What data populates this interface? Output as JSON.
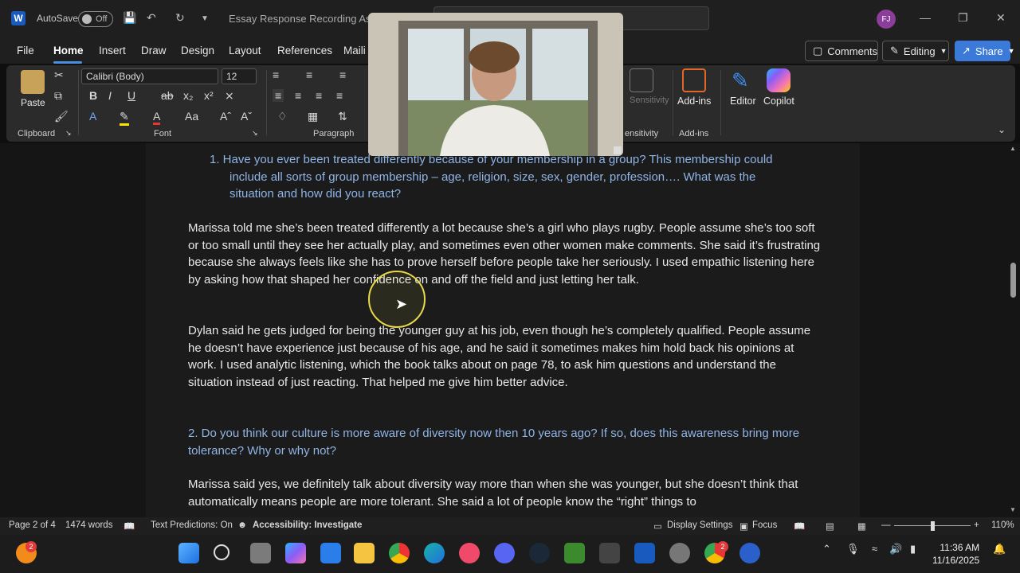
{
  "titlebar": {
    "autosave_label": "AutoSave",
    "autosave_state": "Off",
    "doc_title": "Essay Response Recording Assig",
    "avatar_initials": "FJ"
  },
  "menu": {
    "items": [
      "File",
      "Home",
      "Insert",
      "Draw",
      "Design",
      "Layout",
      "References",
      "Maili"
    ],
    "active": "Home",
    "comments_label": "Comments",
    "editing_label": "Editing",
    "share_label": "Share"
  },
  "ribbon": {
    "paste_label": "Paste",
    "clipboard_label": "Clipboard",
    "font_name": "Calibri (Body)",
    "font_size": "12",
    "font_label": "Font",
    "paragraph_label": "Paragraph",
    "sensitivity_label": "Sensitivity",
    "sensitivity_group": "ensitivity",
    "addins_label": "Add-ins",
    "addins_group": "Add-ins",
    "editor_label": "Editor",
    "copilot_label": "Copilot"
  },
  "document": {
    "q1": "1.   Have you ever been treated differently because of your membership in a group?  This membership could include all sorts of group membership – age, religion, size, sex, gender, profession…. What was the situation and how did you react?",
    "p1": "Marissa told me she’s been treated differently a lot because she’s a girl who plays rugby. People assume she’s too soft or too small until they see her actually play, and sometimes even other women make comments. She said it’s frustrating because she always feels like she has to prove herself before people take her seriously. I used empathic listening here by asking how that shaped her confidence on and off the field and just letting her talk.",
    "p2": "Dylan said he gets judged for being the younger guy at his job, even though he’s completely qualified. People assume he doesn’t have experience just because of his age, and he said it sometimes makes him hold back his opinions at work. I used analytic listening, which the book talks about on page 78, to ask him questions and understand the situation instead of just reacting. That helped me give him better advice.",
    "q2": "2.  Do you think our culture is more aware of diversity now then 10 years ago?  If so, does this awareness bring more tolerance?  Why or why not?",
    "p3": "Marissa said yes, we definitely talk about diversity way more than when she was younger, but she doesn’t think that automatically means people are more tolerant. She said a lot of people know the “right” things to"
  },
  "status": {
    "page": "Page 2 of 4",
    "words": "1474 words",
    "predictions": "Text Predictions: On",
    "accessibility": "Accessibility: Investigate",
    "display": "Display Settings",
    "focus": "Focus",
    "zoom": "110%"
  },
  "taskbar": {
    "badge": "2",
    "notif_badge": "2",
    "time": "11:36 AM",
    "date": "11/16/2025"
  },
  "colors": {
    "accent": "#3b7ad9",
    "question_text": "#8fb4e6",
    "word_blue": "#185abd"
  }
}
